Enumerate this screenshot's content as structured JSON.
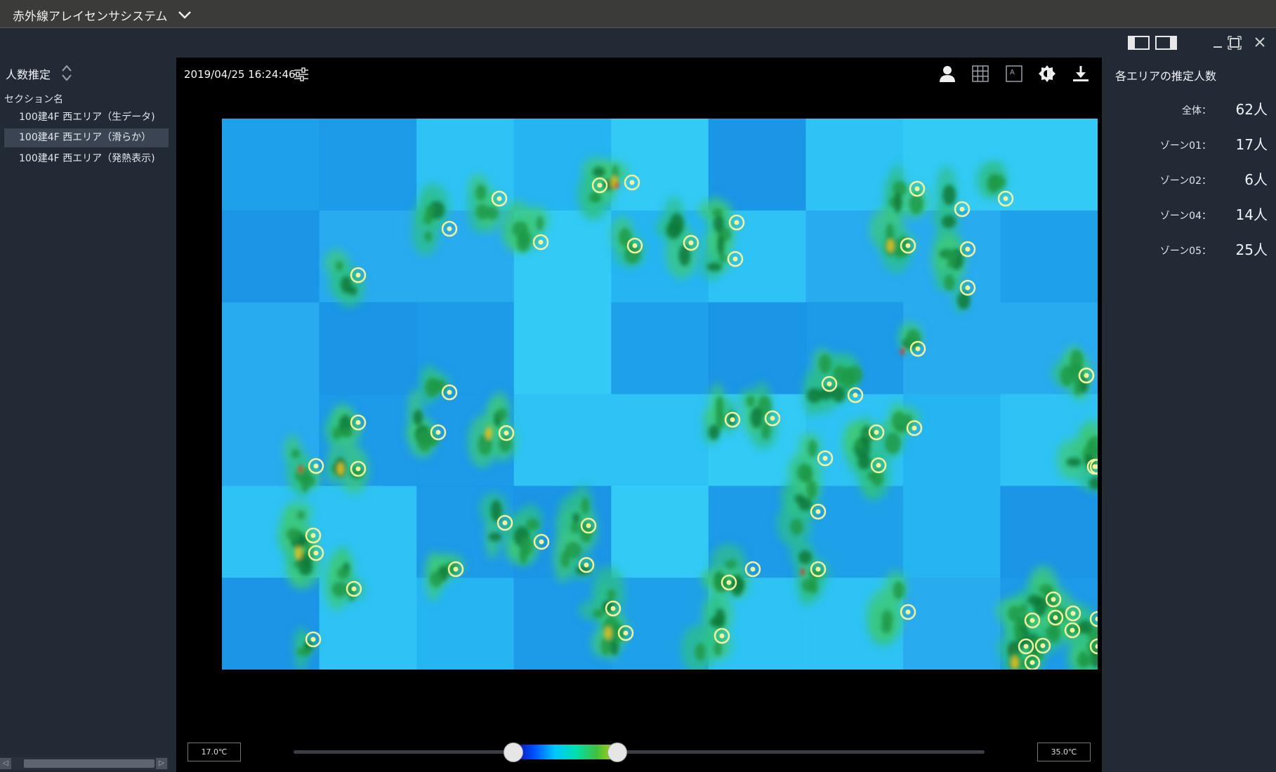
{
  "app": {
    "title": "赤外線アレイセンサシステム"
  },
  "left_panel": {
    "title": "人数推定",
    "section_header": "セクション名",
    "sections": [
      {
        "label": "100建4F 西エリア（生データ)",
        "active": false
      },
      {
        "label": "100建4F 西エリア（滑らか）",
        "active": true
      },
      {
        "label": "100建4F 西エリア（発熱表示)",
        "active": false
      }
    ]
  },
  "viewer": {
    "timestamp": "2019/04/25 16:24:46",
    "tools": [
      "person-icon",
      "grid-icon",
      "label-icon",
      "brightness-icon",
      "download-icon"
    ],
    "heat_points_count": 62,
    "temp_min": "17.0℃",
    "temp_max": "35.0℃",
    "range_low_fraction": 0.318,
    "range_high_fraction": 0.469
  },
  "right_panel": {
    "title": "各エリアの推定人数",
    "zones": [
      {
        "label": "全体：",
        "value": "62人"
      },
      {
        "label": "ゾーン01：",
        "value": "17人"
      },
      {
        "label": "ゾーン02：",
        "value": "6人"
      },
      {
        "label": "ゾーン04：",
        "value": "14人"
      },
      {
        "label": "ゾーン05：",
        "value": "25人"
      }
    ]
  },
  "colors": {
    "titlebar": "#3b3b39",
    "panel": "#222a35",
    "selected": "#3a4452",
    "marker": "#f5f29a"
  }
}
